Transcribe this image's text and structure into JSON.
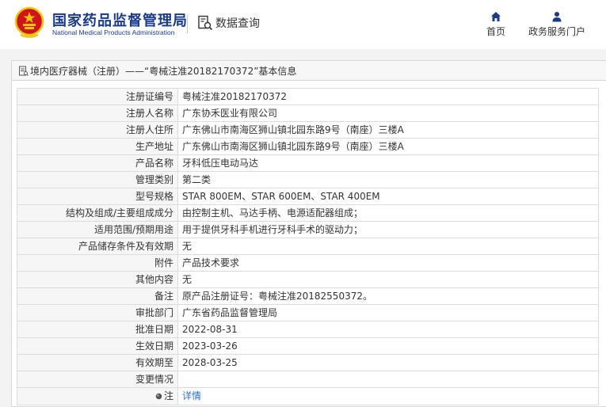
{
  "header": {
    "org_name_cn": "国家药品监督管理局",
    "org_name_en": "National Medical Products Administration",
    "query_label": "数据查询",
    "nav": [
      {
        "label": "首页",
        "icon": "home-icon"
      },
      {
        "label": "政务服务门户",
        "icon": "user-icon"
      }
    ]
  },
  "panel": {
    "title": "境内医疗器械（注册）——“粤械注准20182170372”基本信息"
  },
  "rows": [
    {
      "key": "注册证编号",
      "value": "粤械注准20182170372"
    },
    {
      "key": "注册人名称",
      "value": "广东协禾医业有限公司"
    },
    {
      "key": "注册人住所",
      "value": "广东佛山市南海区狮山镇北园东路9号（南座）三楼A"
    },
    {
      "key": "生产地址",
      "value": "广东佛山市南海区狮山镇北园东路9号（南座）三楼A"
    },
    {
      "key": "产品名称",
      "value": "牙科低压电动马达"
    },
    {
      "key": "管理类别",
      "value": "第二类"
    },
    {
      "key": "型号规格",
      "value": "STAR 800EM、STAR 600EM、STAR 400EM"
    },
    {
      "key": "结构及组成/主要组成成分",
      "value": "由控制主机、马达手柄、电源适配器组成；"
    },
    {
      "key": "适用范围/预期用途",
      "value": "用于提供牙科手机进行牙科手术的驱动力；"
    },
    {
      "key": "产品储存条件及有效期",
      "value": "无"
    },
    {
      "key": "附件",
      "value": "产品技术要求"
    },
    {
      "key": "其他内容",
      "value": "无"
    },
    {
      "key": "备注",
      "value": "原产品注册证号：粤械注准20182550372。"
    },
    {
      "key": "审批部门",
      "value": "广东省药品监督管理局"
    },
    {
      "key": "批准日期",
      "value": "2022-08-31"
    },
    {
      "key": "生效日期",
      "value": "2023-03-26"
    },
    {
      "key": "有效期至",
      "value": "2028-03-25"
    },
    {
      "key": "变更情况",
      "value": ""
    }
  ],
  "note_row": {
    "key": "注",
    "link_text": "详情"
  },
  "colors": {
    "brand_blue": "#1a3b8c",
    "link_blue": "#2a6fd6",
    "emblem_red": "#d0141c",
    "emblem_gold": "#f2c400"
  }
}
